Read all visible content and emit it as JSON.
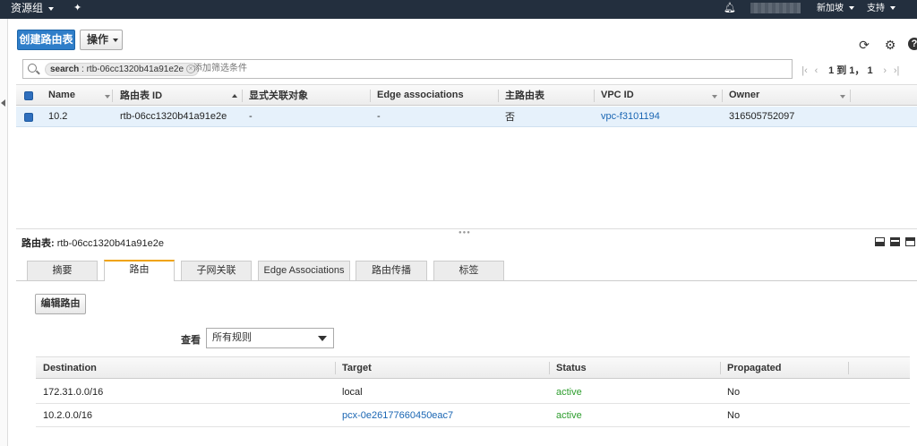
{
  "nav": {
    "resource_groups": "资源组",
    "region": "新加坡",
    "support": "支持"
  },
  "toolbar": {
    "create_label": "创建路由表",
    "actions_label": "操作"
  },
  "search": {
    "token_key": "search",
    "token_value": " : rtb-06cc1320b41a91e2e",
    "placeholder": "添加筛选条件"
  },
  "pager": {
    "text": "1 到 1，  1"
  },
  "table": {
    "columns": [
      "Name",
      "路由表 ID",
      "显式关联对象",
      "Edge associations",
      "主路由表",
      "VPC ID",
      "Owner"
    ],
    "rows": [
      {
        "name": "10.2",
        "id": "rtb-06cc1320b41a91e2e",
        "explicit": "-",
        "edge": "-",
        "main": "否",
        "vpc": "vpc-f3101194",
        "owner": "316505752097"
      }
    ]
  },
  "detail": {
    "title_label": "路由表:",
    "title_value": "rtb-06cc1320b41a91e2e",
    "tabs": [
      "摘要",
      "路由",
      "子网关联",
      "Edge Associations",
      "路由传播",
      "标签"
    ],
    "edit_routes_label": "编辑路由",
    "view_label": "查看",
    "view_value": "所有规则",
    "routes_columns": [
      "Destination",
      "Target",
      "Status",
      "Propagated"
    ],
    "routes": [
      {
        "destination": "172.31.0.0/16",
        "target": "local",
        "status": "active",
        "propagated": "No"
      },
      {
        "destination": "10.2.0.0/16",
        "target": "pcx-0e26177660450eac7",
        "status": "active",
        "propagated": "No"
      }
    ]
  },
  "colors": {
    "nav_bg": "#232f3e",
    "primary": "#2f7ec9",
    "link": "#1a66b3",
    "active_status": "#2d9d2d",
    "tab_accent": "#f0a30a"
  }
}
